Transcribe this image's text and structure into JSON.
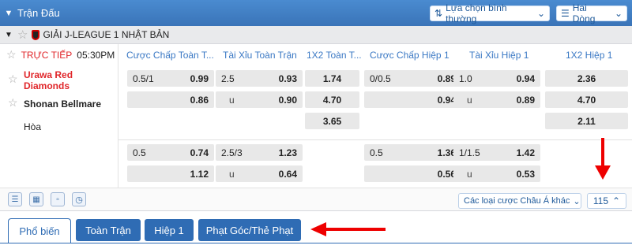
{
  "header": {
    "title": "Trận Đấu",
    "view_select": "Lựa chọn bình thường",
    "lines_select": "Hai Dòng"
  },
  "league": {
    "name": "GIẢI J-LEAGUE 1 NHẬT BẢN"
  },
  "match": {
    "status": "TRỰC TIẾP",
    "time": "05:30PM",
    "home": "Urawa Red Diamonds",
    "away": "Shonan Bellmare",
    "draw": "Hòa"
  },
  "columns": [
    "Cược Chấp Toàn T...",
    "Tài Xỉu Toàn Trận",
    "1X2 Toàn T...",
    "Cược Chấp Hiệp 1",
    "Tài Xỉu Hiệp 1",
    "1X2 Hiệp 1"
  ],
  "odds": {
    "r1": {
      "hdp_ft_line": "0.5/1",
      "hdp_ft_home": "0.99",
      "hdp_ft_away": "0.86",
      "ou_ft_line": "2.5",
      "ou_ft_over": "0.93",
      "ou_ft_u": "u",
      "ou_ft_under": "0.90",
      "x12_ft_1": "1.74",
      "x12_ft_2": "4.70",
      "x12_ft_x": "3.65",
      "hdp_h1_line": "0/0.5",
      "hdp_h1_home": "0.89",
      "hdp_h1_away": "0.94",
      "ou_h1_line": "1.0",
      "ou_h1_over": "0.94",
      "ou_h1_u": "u",
      "ou_h1_under": "0.89",
      "x12_h1_1": "2.36",
      "x12_h1_2": "4.70",
      "x12_h1_x": "2.11"
    },
    "r2": {
      "hdp_ft_line": "0.5",
      "hdp_ft_home": "0.74",
      "hdp_ft_away": "1.12",
      "ou_ft_line": "2.5/3",
      "ou_ft_over": "1.23",
      "ou_ft_u": "u",
      "ou_ft_under": "0.64",
      "hdp_h1_line": "0.5",
      "hdp_h1_home": "1.36",
      "hdp_h1_away": "0.56",
      "ou_h1_line": "1/1.5",
      "ou_h1_over": "1.42",
      "ou_h1_u": "u",
      "ou_h1_under": "0.53"
    }
  },
  "toolbar": {
    "bet_type_select": "Các loại cược Châu Á khác",
    "count": "115"
  },
  "tabs": [
    "Phổ biến",
    "Toàn Trận",
    "Hiệp 1",
    "Phạt Góc/Thẻ Phạt"
  ],
  "colors": {
    "header": "#3f7fc4",
    "tab_blue": "#2f6cb4",
    "live_red": "#e0262a",
    "arrow": "#e00000"
  }
}
